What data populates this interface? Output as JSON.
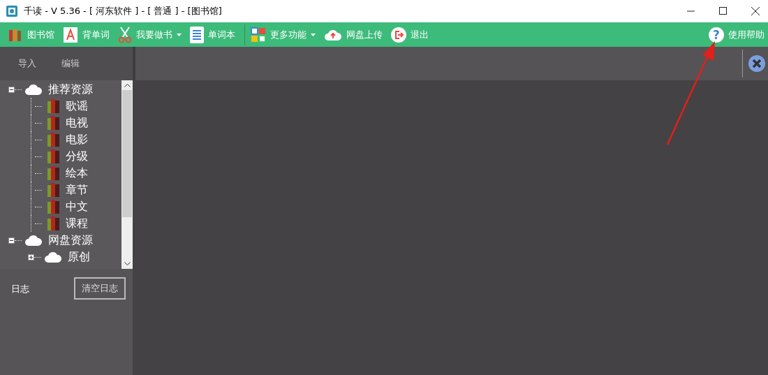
{
  "window": {
    "title": "千读 - V 5.36 - [ 河东软件 ] - [ 普通 ] - [图书馆]"
  },
  "toolbar": [
    {
      "label": "图书馆",
      "kind": "library",
      "dropdown": false,
      "separator_before": false
    },
    {
      "label": "背单词",
      "kind": "letter",
      "dropdown": false,
      "separator_before": false
    },
    {
      "label": "我要做书",
      "kind": "scissors",
      "dropdown": true,
      "separator_before": false
    },
    {
      "label": "单词本",
      "kind": "notebook",
      "dropdown": false,
      "separator_before": false
    },
    {
      "label": "更多功能",
      "kind": "grid",
      "dropdown": true,
      "separator_before": true
    },
    {
      "label": "网盘上传",
      "kind": "upload",
      "dropdown": false,
      "separator_before": false
    },
    {
      "label": "退出",
      "kind": "exit",
      "dropdown": false,
      "separator_before": false
    }
  ],
  "help": {
    "label": "使用帮助",
    "icon_text": "?"
  },
  "sidebar": {
    "tabs": [
      {
        "label": "导入"
      },
      {
        "label": "编辑"
      }
    ],
    "tree": [
      {
        "label": "推荐资源",
        "kind": "cloud",
        "expanded": true,
        "children": [
          {
            "label": "歌谣",
            "kind": "book"
          },
          {
            "label": "电视",
            "kind": "book"
          },
          {
            "label": "电影",
            "kind": "book"
          },
          {
            "label": "分级",
            "kind": "book"
          },
          {
            "label": "绘本",
            "kind": "book"
          },
          {
            "label": "章节",
            "kind": "book"
          },
          {
            "label": "中文",
            "kind": "book"
          },
          {
            "label": "课程",
            "kind": "book"
          }
        ]
      },
      {
        "label": "网盘资源",
        "kind": "cloud",
        "expanded": true,
        "children": [
          {
            "label": "原创",
            "kind": "cloud",
            "expanded": false
          }
        ]
      }
    ]
  },
  "log": {
    "label": "日志",
    "clear_button": "清空日志"
  }
}
